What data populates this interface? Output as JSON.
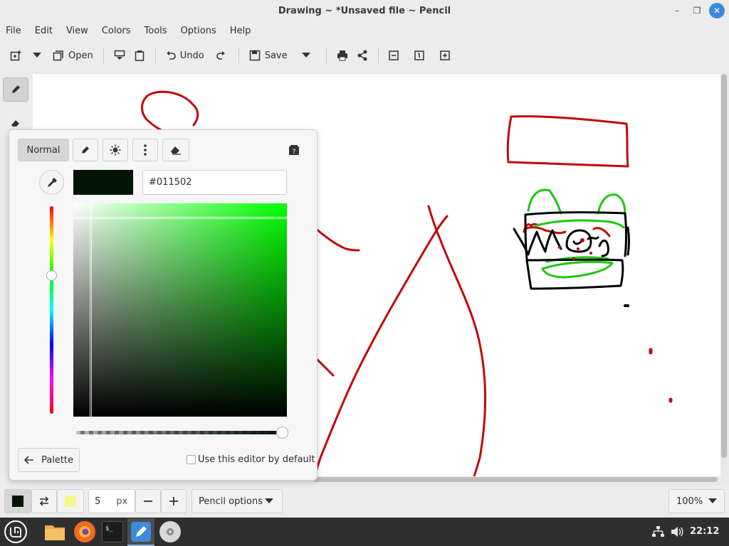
{
  "window": {
    "title": "Drawing ~ *Unsaved file ~ Pencil"
  },
  "menu": {
    "items": [
      "File",
      "Edit",
      "View",
      "Colors",
      "Tools",
      "Options",
      "Help"
    ]
  },
  "toolbar": {
    "open_label": "Open",
    "undo_label": "Undo",
    "save_label": "Save"
  },
  "color_editor": {
    "mode_normal": "Normal",
    "hex_value": "#011502",
    "palette_button": "Palette",
    "default_checkbox_label": "Use this editor by default",
    "default_checked": false
  },
  "bottom": {
    "size_value": "5",
    "size_unit": "px",
    "tool_options": "Pencil options",
    "zoom": "100%"
  },
  "colors": {
    "primary": "#011502",
    "secondary": "#f6f58b",
    "accent": "#3c8ad9"
  },
  "taskbar": {
    "clock": "22:12"
  }
}
